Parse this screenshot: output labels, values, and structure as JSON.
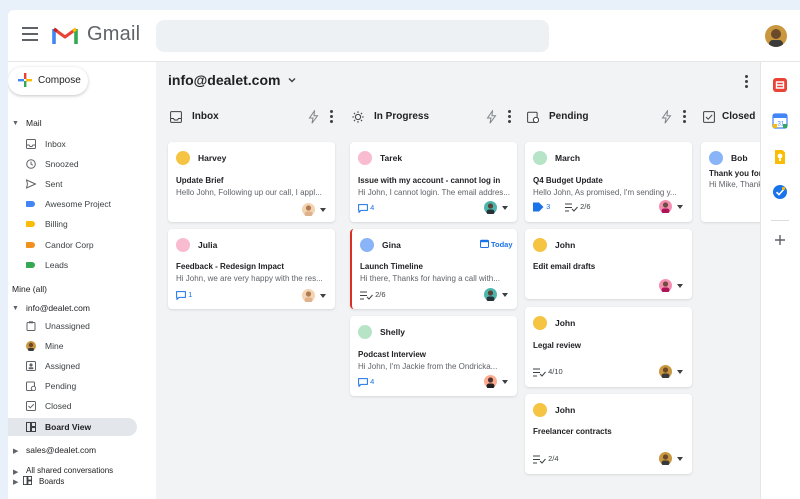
{
  "brand": {
    "name": "Gmail"
  },
  "sidebar": {
    "compose_label": "Compose",
    "mail_section": "Mail",
    "mail_items": [
      {
        "label": "Inbox",
        "icon": "inbox-icon"
      },
      {
        "label": "Snoozed",
        "icon": "clock-icon"
      },
      {
        "label": "Sent",
        "icon": "send-icon"
      },
      {
        "label": "Awesome Project",
        "icon": "label-icon",
        "color": "#4285f4"
      },
      {
        "label": "Billing",
        "icon": "label-icon",
        "color": "#fbbc04"
      },
      {
        "label": "Candor Corp",
        "icon": "label-icon",
        "color": "#f4911e"
      },
      {
        "label": "Leads",
        "icon": "label-icon",
        "color": "#34a853"
      }
    ],
    "mine_section": "Mine (all)",
    "account_label": "info@dealet.com",
    "account_items": [
      {
        "label": "Unassigned",
        "icon": "clipboard-icon"
      },
      {
        "label": "Mine",
        "icon": "avatar"
      },
      {
        "label": "Assigned",
        "icon": "assigned-icon"
      },
      {
        "label": "Pending",
        "icon": "pending-icon"
      },
      {
        "label": "Closed",
        "icon": "checkbox-icon"
      },
      {
        "label": "Board View",
        "icon": "board-icon",
        "active": true
      }
    ],
    "sales_account": "sales@dealet.com",
    "shared_label": "All shared conversations",
    "boards_label": "Boards"
  },
  "main": {
    "account_title": "info@dealet.com",
    "columns": [
      {
        "title": "Inbox",
        "icon": "inbox-icon",
        "cards": [
          {
            "name": "Harvey",
            "dot": "#f6c443",
            "subject": "Update Brief",
            "snippet": "Hello John, Following up our call, I appl...",
            "comments": "",
            "progress": ""
          },
          {
            "name": "Julia",
            "dot": "#f8bbd0",
            "subject": "Feedback - Redesign Impact",
            "snippet": "Hi John, we are very happy with the res...",
            "comments": "1",
            "progress": ""
          }
        ]
      },
      {
        "title": "In Progress",
        "icon": "sun-icon",
        "cards": [
          {
            "name": "Tarek",
            "dot": "#f8bbd0",
            "subject": "Issue with my account - cannot log in",
            "snippet": "Hi John, I cannot login. The email addres...",
            "comments": "4",
            "progress": ""
          },
          {
            "name": "Gina",
            "dot": "#8ab4f8",
            "subject": "Launch Timeline",
            "snippet": "Hi there, Thanks for having a call with...",
            "comments": "",
            "progress": "2/6",
            "badge": "Today"
          },
          {
            "name": "Shelly",
            "dot": "#b7e4c7",
            "subject": "Podcast Interview",
            "snippet": "Hi John, I'm Jackie from the Ondricka...",
            "comments": "4",
            "progress": ""
          }
        ]
      },
      {
        "title": "Pending",
        "icon": "pending-icon",
        "cards": [
          {
            "name": "March",
            "dot": "#b7e4c7",
            "subject": "Q4 Budget Update",
            "snippet": "Hello John, As promised, I'm sending y...",
            "tags": "3",
            "progress": "2/6"
          },
          {
            "name": "John",
            "dot": "#f6c443",
            "subject": "Edit email drafts",
            "snippet": "",
            "progress": ""
          },
          {
            "name": "John",
            "dot": "#f6c443",
            "subject": "Legal review",
            "snippet": "",
            "progress": "4/10"
          },
          {
            "name": "John",
            "dot": "#f6c443",
            "subject": "Freelancer contracts",
            "snippet": "",
            "progress": "2/4"
          }
        ]
      },
      {
        "title": "Closed",
        "icon": "checkbox-icon",
        "cards": [
          {
            "name": "Bob",
            "dot": "#8ab4f8",
            "subject": "Thank you for y",
            "snippet": "Hi Mike, Thank"
          }
        ]
      }
    ]
  },
  "rail": {
    "apps": [
      "gmelius-icon",
      "calendar-icon",
      "keep-icon",
      "tasks-icon"
    ],
    "add": "add-icon"
  },
  "colors": {
    "accent": "#1a73e8",
    "active_bg": "#e3e6ea",
    "canvas": "#f1f3f4",
    "outer": "#e8f0fa"
  }
}
